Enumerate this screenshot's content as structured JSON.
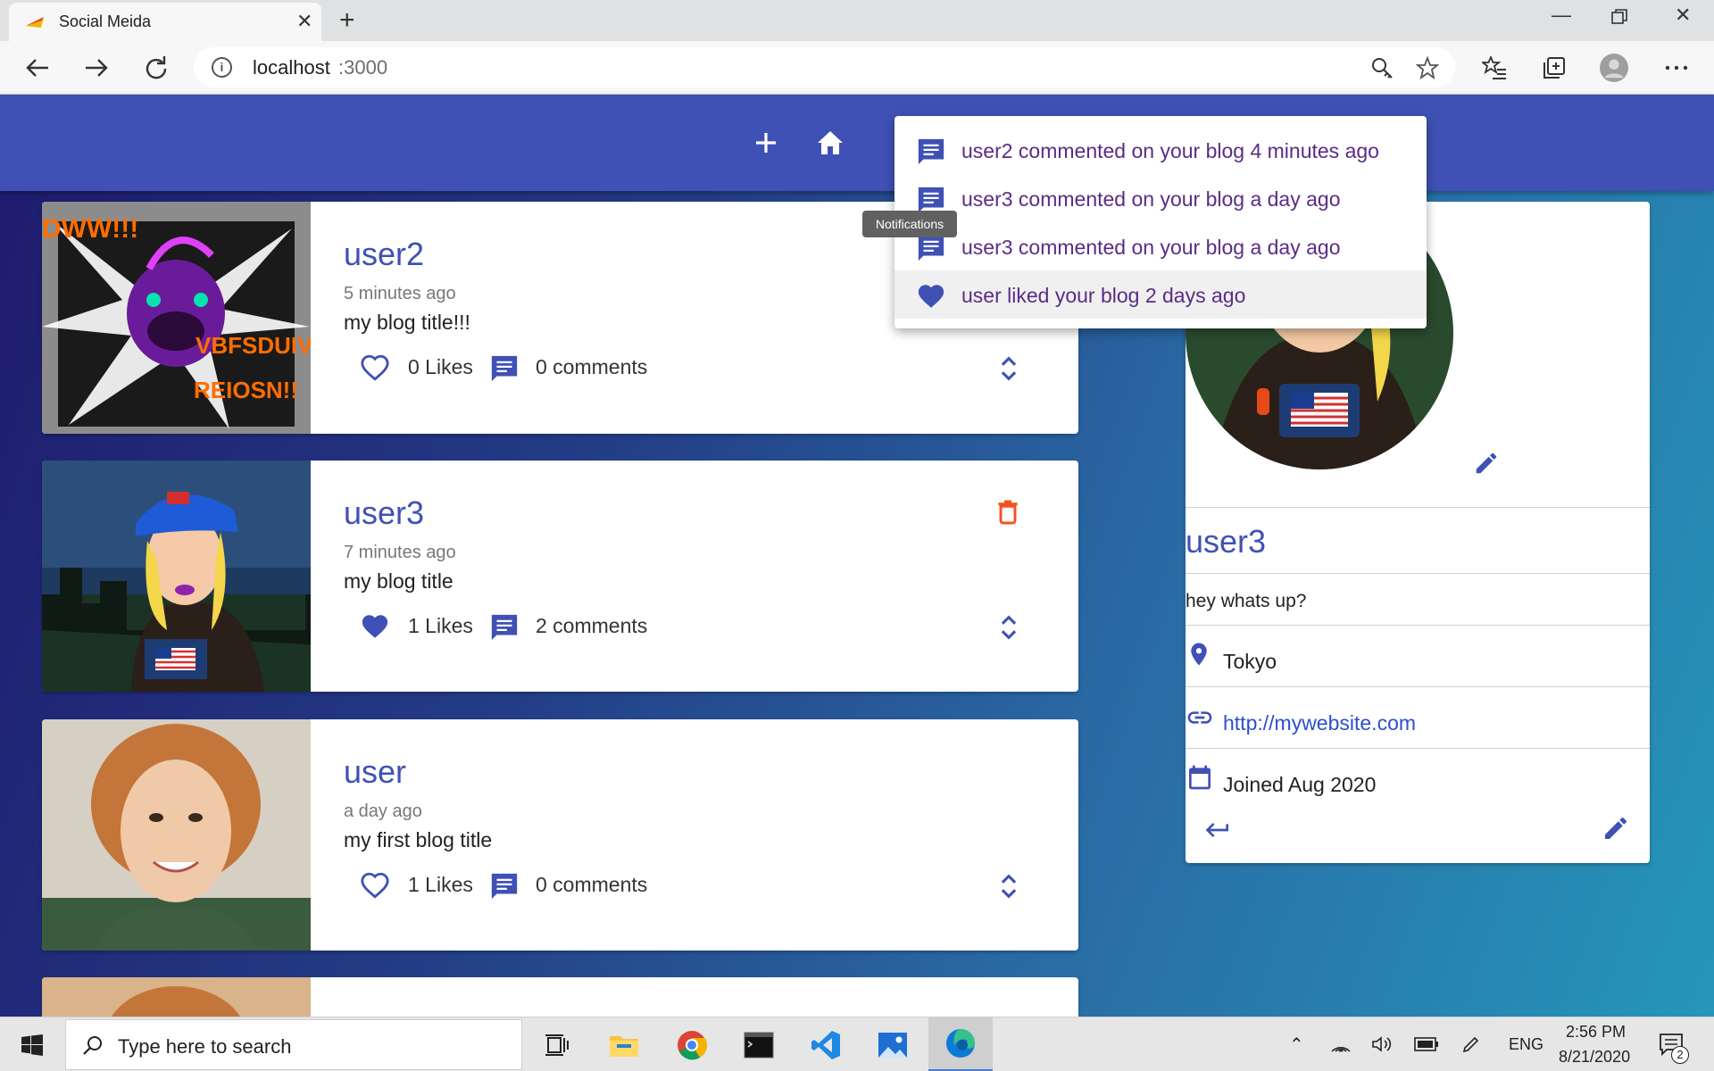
{
  "browser": {
    "tab_title": "Social Meida",
    "url_host": "localhost",
    "url_port": ":3000"
  },
  "posts": [
    {
      "user": "user2",
      "time": "5 minutes ago",
      "body": "my blog title!!!",
      "likes": "0 Likes",
      "comments": "0 comments",
      "liked": false,
      "owner": false
    },
    {
      "user": "user3",
      "time": "7 minutes ago",
      "body": "my blog title",
      "likes": "1 Likes",
      "comments": "2 comments",
      "liked": true,
      "owner": true
    },
    {
      "user": "user",
      "time": "a day ago",
      "body": "my first blog title",
      "likes": "1 Likes",
      "comments": "0 comments",
      "liked": false,
      "owner": false
    }
  ],
  "notifications": {
    "tooltip": "Notifications",
    "items": [
      {
        "text": "user2 commented on your blog 4 minutes ago",
        "icon": "comment-icon"
      },
      {
        "text": "user3 commented on your blog a day ago",
        "icon": "comment-icon"
      },
      {
        "text": "user3 commented on your blog a day ago",
        "icon": "comment-icon"
      },
      {
        "text": "user liked your blog 2 days ago",
        "icon": "heart-icon"
      }
    ]
  },
  "profile": {
    "name": "user3",
    "bio": "hey whats up?",
    "location": "Tokyo",
    "website": "http://mywebsite.com",
    "joined": "Joined Aug 2020"
  },
  "taskbar": {
    "search_placeholder": "Type here to search",
    "language": "ENG",
    "time": "2:56 PM",
    "date": "8/21/2020",
    "notification_count": "2"
  },
  "colors": {
    "primary": "#3f51b5",
    "notification_text": "#5a2c87",
    "delete": "#f4511e"
  }
}
